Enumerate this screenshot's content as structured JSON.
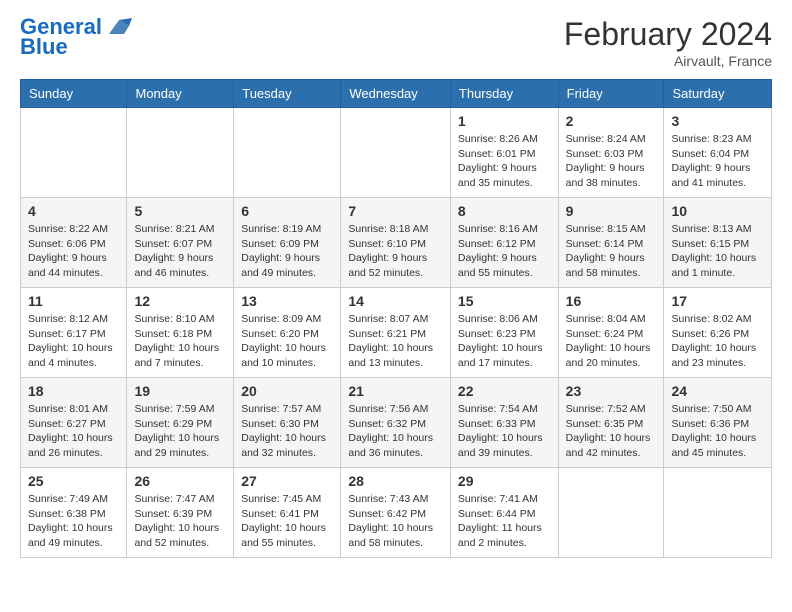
{
  "logo": {
    "line1": "General",
    "line2": "Blue"
  },
  "header": {
    "month_year": "February 2024",
    "location": "Airvault, France"
  },
  "weekdays": [
    "Sunday",
    "Monday",
    "Tuesday",
    "Wednesday",
    "Thursday",
    "Friday",
    "Saturday"
  ],
  "weeks": [
    [
      {
        "day": "",
        "info": ""
      },
      {
        "day": "",
        "info": ""
      },
      {
        "day": "",
        "info": ""
      },
      {
        "day": "",
        "info": ""
      },
      {
        "day": "1",
        "info": "Sunrise: 8:26 AM\nSunset: 6:01 PM\nDaylight: 9 hours and 35 minutes."
      },
      {
        "day": "2",
        "info": "Sunrise: 8:24 AM\nSunset: 6:03 PM\nDaylight: 9 hours and 38 minutes."
      },
      {
        "day": "3",
        "info": "Sunrise: 8:23 AM\nSunset: 6:04 PM\nDaylight: 9 hours and 41 minutes."
      }
    ],
    [
      {
        "day": "4",
        "info": "Sunrise: 8:22 AM\nSunset: 6:06 PM\nDaylight: 9 hours and 44 minutes."
      },
      {
        "day": "5",
        "info": "Sunrise: 8:21 AM\nSunset: 6:07 PM\nDaylight: 9 hours and 46 minutes."
      },
      {
        "day": "6",
        "info": "Sunrise: 8:19 AM\nSunset: 6:09 PM\nDaylight: 9 hours and 49 minutes."
      },
      {
        "day": "7",
        "info": "Sunrise: 8:18 AM\nSunset: 6:10 PM\nDaylight: 9 hours and 52 minutes."
      },
      {
        "day": "8",
        "info": "Sunrise: 8:16 AM\nSunset: 6:12 PM\nDaylight: 9 hours and 55 minutes."
      },
      {
        "day": "9",
        "info": "Sunrise: 8:15 AM\nSunset: 6:14 PM\nDaylight: 9 hours and 58 minutes."
      },
      {
        "day": "10",
        "info": "Sunrise: 8:13 AM\nSunset: 6:15 PM\nDaylight: 10 hours and 1 minute."
      }
    ],
    [
      {
        "day": "11",
        "info": "Sunrise: 8:12 AM\nSunset: 6:17 PM\nDaylight: 10 hours and 4 minutes."
      },
      {
        "day": "12",
        "info": "Sunrise: 8:10 AM\nSunset: 6:18 PM\nDaylight: 10 hours and 7 minutes."
      },
      {
        "day": "13",
        "info": "Sunrise: 8:09 AM\nSunset: 6:20 PM\nDaylight: 10 hours and 10 minutes."
      },
      {
        "day": "14",
        "info": "Sunrise: 8:07 AM\nSunset: 6:21 PM\nDaylight: 10 hours and 13 minutes."
      },
      {
        "day": "15",
        "info": "Sunrise: 8:06 AM\nSunset: 6:23 PM\nDaylight: 10 hours and 17 minutes."
      },
      {
        "day": "16",
        "info": "Sunrise: 8:04 AM\nSunset: 6:24 PM\nDaylight: 10 hours and 20 minutes."
      },
      {
        "day": "17",
        "info": "Sunrise: 8:02 AM\nSunset: 6:26 PM\nDaylight: 10 hours and 23 minutes."
      }
    ],
    [
      {
        "day": "18",
        "info": "Sunrise: 8:01 AM\nSunset: 6:27 PM\nDaylight: 10 hours and 26 minutes."
      },
      {
        "day": "19",
        "info": "Sunrise: 7:59 AM\nSunset: 6:29 PM\nDaylight: 10 hours and 29 minutes."
      },
      {
        "day": "20",
        "info": "Sunrise: 7:57 AM\nSunset: 6:30 PM\nDaylight: 10 hours and 32 minutes."
      },
      {
        "day": "21",
        "info": "Sunrise: 7:56 AM\nSunset: 6:32 PM\nDaylight: 10 hours and 36 minutes."
      },
      {
        "day": "22",
        "info": "Sunrise: 7:54 AM\nSunset: 6:33 PM\nDaylight: 10 hours and 39 minutes."
      },
      {
        "day": "23",
        "info": "Sunrise: 7:52 AM\nSunset: 6:35 PM\nDaylight: 10 hours and 42 minutes."
      },
      {
        "day": "24",
        "info": "Sunrise: 7:50 AM\nSunset: 6:36 PM\nDaylight: 10 hours and 45 minutes."
      }
    ],
    [
      {
        "day": "25",
        "info": "Sunrise: 7:49 AM\nSunset: 6:38 PM\nDaylight: 10 hours and 49 minutes."
      },
      {
        "day": "26",
        "info": "Sunrise: 7:47 AM\nSunset: 6:39 PM\nDaylight: 10 hours and 52 minutes."
      },
      {
        "day": "27",
        "info": "Sunrise: 7:45 AM\nSunset: 6:41 PM\nDaylight: 10 hours and 55 minutes."
      },
      {
        "day": "28",
        "info": "Sunrise: 7:43 AM\nSunset: 6:42 PM\nDaylight: 10 hours and 58 minutes."
      },
      {
        "day": "29",
        "info": "Sunrise: 7:41 AM\nSunset: 6:44 PM\nDaylight: 11 hours and 2 minutes."
      },
      {
        "day": "",
        "info": ""
      },
      {
        "day": "",
        "info": ""
      }
    ]
  ]
}
